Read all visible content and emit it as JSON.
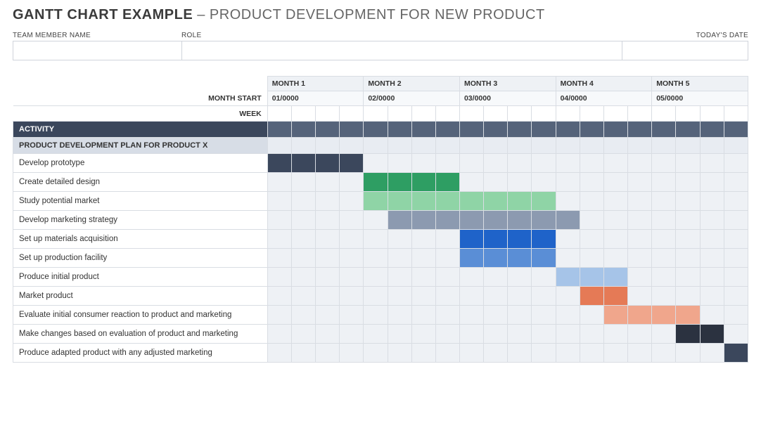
{
  "title_bold": "GANTT CHART EXAMPLE",
  "title_sep": " – ",
  "title_thin": "PRODUCT DEVELOPMENT FOR NEW PRODUCT",
  "meta": {
    "name_label": "TEAM MEMBER NAME",
    "name_value": "",
    "role_label": "ROLE",
    "role_value": "",
    "date_label": "TODAY'S DATE",
    "date_value": ""
  },
  "col_labels": {
    "month_start": "MONTH START",
    "week": "WEEK"
  },
  "months": [
    {
      "name": "MONTH 1",
      "start": "01/0000"
    },
    {
      "name": "MONTH 2",
      "start": "02/0000"
    },
    {
      "name": "MONTH 3",
      "start": "03/0000"
    },
    {
      "name": "MONTH 4",
      "start": "04/0000"
    },
    {
      "name": "MONTH 5",
      "start": "05/0000"
    }
  ],
  "weeks_per_month": 4,
  "activity_header": "ACTIVITY",
  "section_header": "PRODUCT DEVELOPMENT PLAN FOR PRODUCT X",
  "tasks": [
    {
      "name": "Develop prototype",
      "start_week": 1,
      "duration": 4,
      "color": "#3b475c"
    },
    {
      "name": "Create detailed design",
      "start_week": 5,
      "duration": 4,
      "color": "#2e9e63"
    },
    {
      "name": "Study potential market",
      "start_week": 5,
      "duration": 8,
      "color": "#8fd4a6"
    },
    {
      "name": "Develop marketing strategy",
      "start_week": 6,
      "duration": 8,
      "color": "#8c9ab0"
    },
    {
      "name": "Set up materials acquisition",
      "start_week": 9,
      "duration": 4,
      "color": "#1f63c9"
    },
    {
      "name": "Set up production facility",
      "start_week": 9,
      "duration": 4,
      "color": "#5a8ed6"
    },
    {
      "name": "Produce initial product",
      "start_week": 13,
      "duration": 3,
      "color": "#a6c4e8"
    },
    {
      "name": "Market product",
      "start_week": 14,
      "duration": 2,
      "color": "#e57a56"
    },
    {
      "name": "Evaluate initial consumer reaction to product and marketing",
      "start_week": 15,
      "duration": 4,
      "color": "#f0a68c"
    },
    {
      "name": "Make changes based on evaluation of product and marketing",
      "start_week": 18,
      "duration": 2,
      "color": "#2b3240"
    },
    {
      "name": "Produce adapted product with any adjusted marketing",
      "start_week": 20,
      "duration": 1,
      "color": "#3b475c"
    }
  ],
  "chart_data": {
    "type": "bar",
    "title": "GANTT CHART EXAMPLE – PRODUCT DEVELOPMENT FOR NEW PRODUCT",
    "xlabel": "Week",
    "ylabel": "Activity",
    "xlim": [
      1,
      20
    ],
    "x_groups": [
      "MONTH 1",
      "MONTH 2",
      "MONTH 3",
      "MONTH 4",
      "MONTH 5"
    ],
    "categories": [
      "Develop prototype",
      "Create detailed design",
      "Study potential market",
      "Develop marketing strategy",
      "Set up materials acquisition",
      "Set up production facility",
      "Produce initial product",
      "Market product",
      "Evaluate initial consumer reaction to product and marketing",
      "Make changes based on evaluation of product and marketing",
      "Produce adapted product with any adjusted marketing"
    ],
    "series": [
      {
        "name": "start_week",
        "values": [
          1,
          5,
          5,
          6,
          9,
          9,
          13,
          14,
          15,
          18,
          20
        ]
      },
      {
        "name": "duration_weeks",
        "values": [
          4,
          4,
          8,
          8,
          4,
          4,
          3,
          2,
          4,
          2,
          1
        ]
      }
    ]
  }
}
